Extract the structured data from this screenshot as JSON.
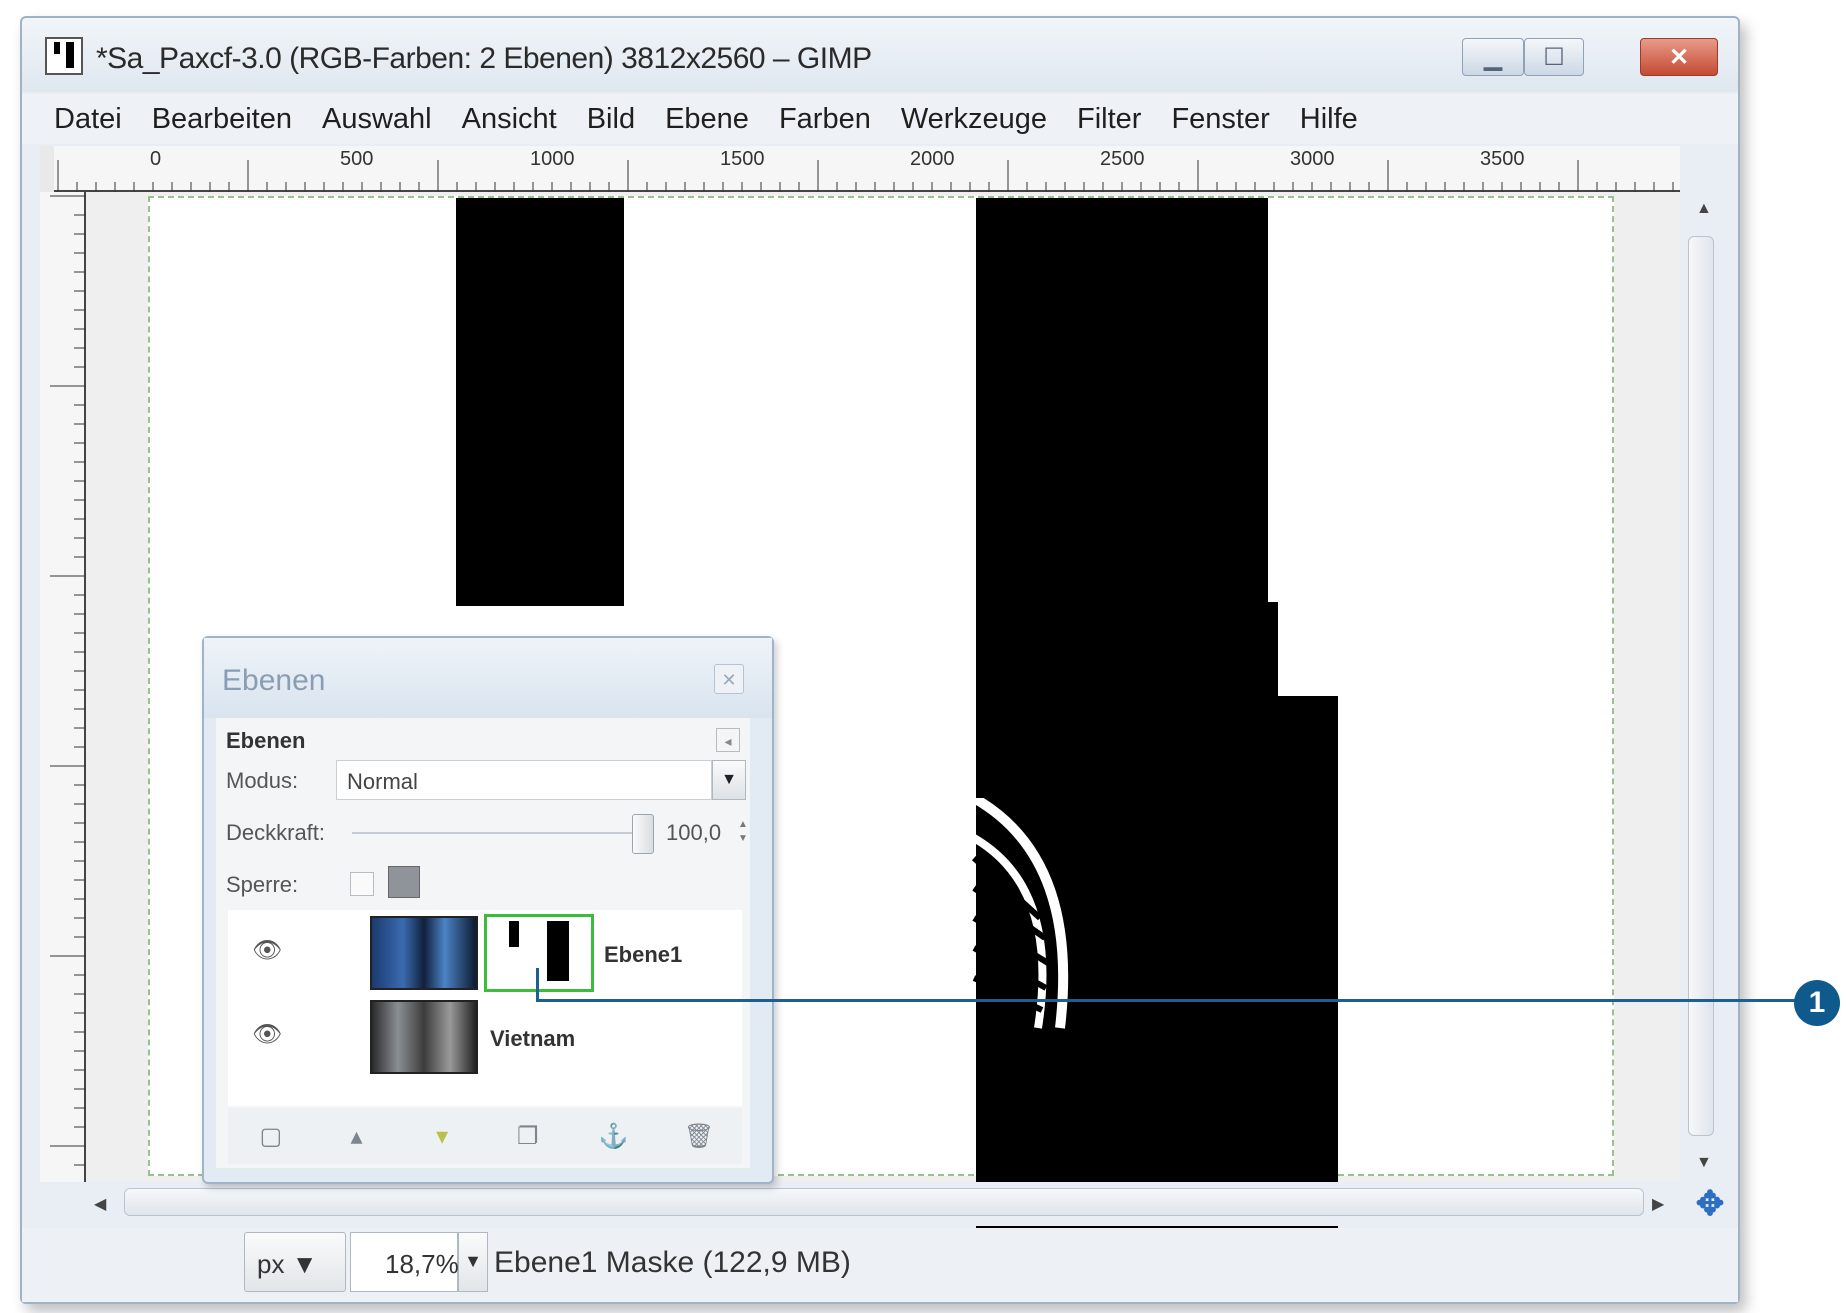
{
  "window": {
    "title": "*Sa_Paxcf-3.0 (RGB-Farben: 2 Ebenen) 3812x2560 – GIMP",
    "min_icon": "minimize-icon",
    "max_icon": "maximize-icon",
    "close_icon": "close-icon",
    "close_glyph": "✕"
  },
  "menu": [
    "Datei",
    "Bearbeiten",
    "Auswahl",
    "Ansicht",
    "Bild",
    "Ebene",
    "Farben",
    "Werkzeuge",
    "Filter",
    "Fenster",
    "Hilfe"
  ],
  "ruler": {
    "h_labels": [
      "0",
      "500",
      "1000",
      "1500",
      "2000",
      "2500",
      "3000",
      "3500"
    ]
  },
  "layers_dialog": {
    "title": "Ebenen",
    "tab_label": "Ebenen",
    "mode_label": "Modus:",
    "mode_value": "Normal",
    "opacity_label": "Deckkraft:",
    "opacity_value": "100,0",
    "opacity_fraction": 1.0,
    "lock_label": "Sperre:",
    "layers": [
      {
        "name": "Ebene1",
        "has_mask": true
      },
      {
        "name": "Vietnam",
        "has_mask": false
      }
    ],
    "toolbar_icons": [
      "new-layer-icon",
      "raise-layer-icon",
      "lower-layer-icon",
      "duplicate-layer-icon",
      "anchor-layer-icon",
      "delete-layer-icon"
    ]
  },
  "statusbar": {
    "unit": "px",
    "zoom": "18,7%",
    "message": "Ebene1 Maske (122,9 MB)"
  },
  "callout": {
    "number": "1"
  },
  "colors": {
    "callout": "#0f5a8c",
    "mask_selected_border": "#3bbd3b",
    "close_button": "#c44a33"
  }
}
